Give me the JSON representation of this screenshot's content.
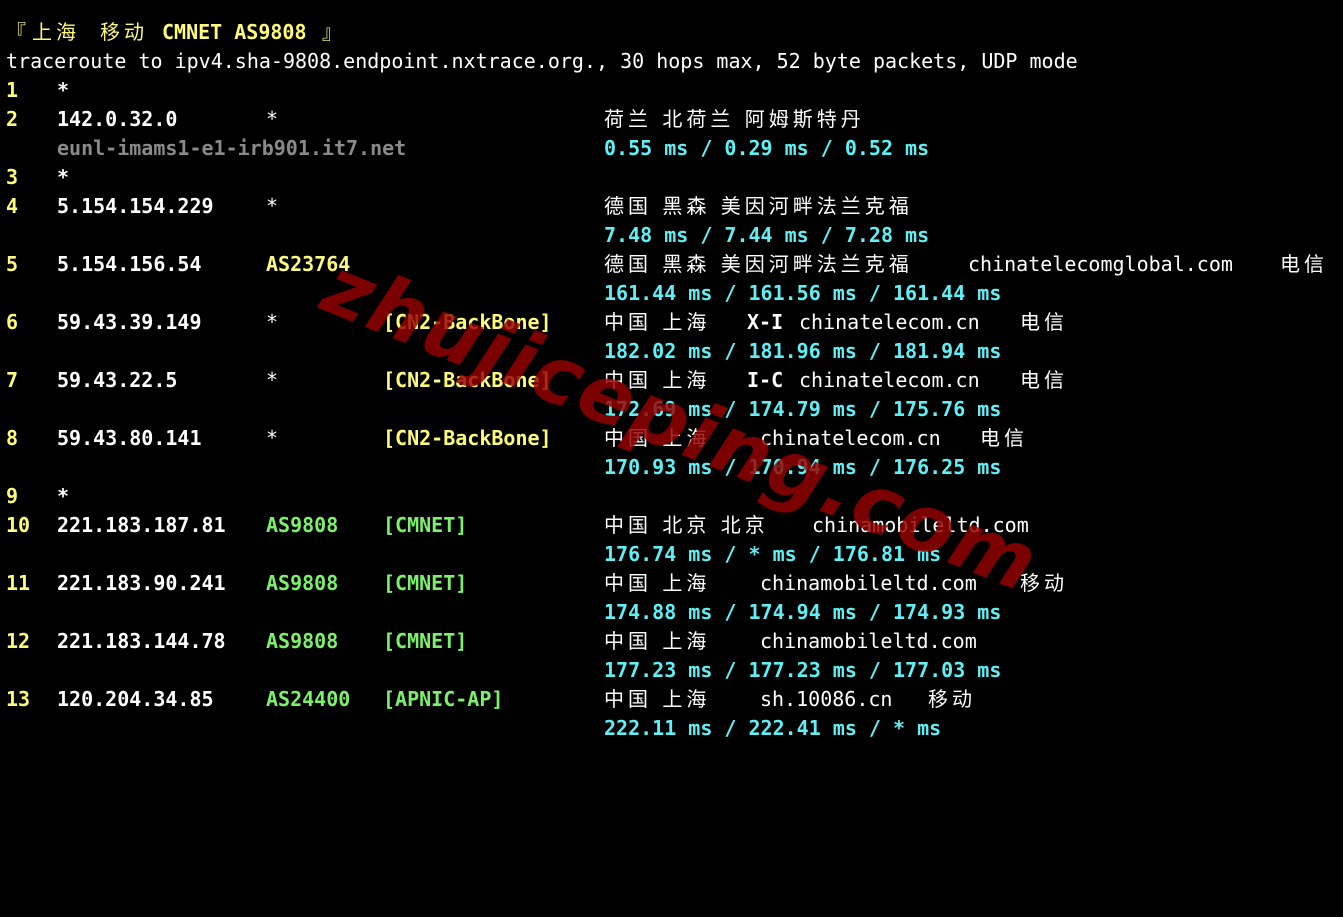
{
  "header": {
    "bracket_open": "『",
    "city": "上海",
    "isp": "移动",
    "net": "CMNET AS9808",
    "bracket_close": "』"
  },
  "command_line": "traceroute to ipv4.sha-9808.endpoint.nxtrace.org., 30 hops max, 52 byte packets, UDP mode",
  "hops": [
    {
      "n": "1",
      "ip": "*"
    },
    {
      "n": "2",
      "ip": "142.0.32.0",
      "asn": "*",
      "geo": "荷兰 北荷兰 阿姆斯特丹",
      "hostname": "eunl-imams1-e1-irb901.it7.net",
      "rtt": "0.55 ms / 0.29 ms / 0.52 ms"
    },
    {
      "n": "3",
      "ip": "*"
    },
    {
      "n": "4",
      "ip": "5.154.154.229",
      "asn": "*",
      "geo": "德国 黑森 美因河畔法兰克福",
      "rtt": "7.48 ms / 7.44 ms / 7.28 ms"
    },
    {
      "n": "5",
      "ip": "5.154.156.54",
      "asn": "AS23764",
      "geo": "德国 黑森 美因河畔法兰克福",
      "domain": "chinatelecomglobal.com",
      "owner": "电信",
      "rtt": "161.44 ms / 161.56 ms / 161.44 ms"
    },
    {
      "n": "6",
      "ip": "59.43.39.149",
      "asn": "*",
      "tag": "[CN2-BackBone]",
      "geo": "中国 上海",
      "label": "X-I",
      "domain": "chinatelecom.cn",
      "owner": "电信",
      "rtt": "182.02 ms / 181.96 ms / 181.94 ms"
    },
    {
      "n": "7",
      "ip": "59.43.22.5",
      "asn": "*",
      "tag": "[CN2-BackBone]",
      "geo": "中国 上海",
      "label": "I-C",
      "domain": "chinatelecom.cn",
      "owner": "电信",
      "rtt": "172.69 ms / 174.79 ms / 175.76 ms"
    },
    {
      "n": "8",
      "ip": "59.43.80.141",
      "asn": "*",
      "tag": "[CN2-BackBone]",
      "geo": "中国 上海",
      "domain": "chinatelecom.cn",
      "owner": "电信",
      "rtt": "170.93 ms / 170.94 ms / 176.25 ms"
    },
    {
      "n": "9",
      "ip": "*"
    },
    {
      "n": "10",
      "ip": "221.183.187.81",
      "asn": "AS9808",
      "tag": "[CMNET]",
      "geo": "中国 北京 北京",
      "domain": "chinamobileltd.com",
      "rtt": "176.74 ms / * ms / 176.81 ms"
    },
    {
      "n": "11",
      "ip": "221.183.90.241",
      "asn": "AS9808",
      "tag": "[CMNET]",
      "geo": "中国 上海",
      "domain": "chinamobileltd.com",
      "owner": "移动",
      "rtt": "174.88 ms / 174.94 ms / 174.93 ms"
    },
    {
      "n": "12",
      "ip": "221.183.144.78",
      "asn": "AS9808",
      "tag": "[CMNET]",
      "geo": "中国 上海",
      "domain": "chinamobileltd.com",
      "rtt": "177.23 ms / 177.23 ms / 177.03 ms"
    },
    {
      "n": "13",
      "ip": "120.204.34.85",
      "asn": "AS24400",
      "tag": "[APNIC-AP]",
      "geo": "中国 上海",
      "domain": "sh.10086.cn",
      "owner": "移动",
      "rtt": "222.11 ms / 222.41 ms / * ms"
    }
  ],
  "watermark": "zhujiceping.com",
  "colors": {
    "background": "#000000",
    "hop_number": "#fffb7a",
    "ip": "#ffffff",
    "asn_highlight": "#fffb7a",
    "asn_cmnet": "#7cf06a",
    "tag_cn2": "#fffb7a",
    "tag_cmnet": "#7cf06a",
    "rtt": "#5ef0f5",
    "hostname": "#8a8a8a"
  }
}
